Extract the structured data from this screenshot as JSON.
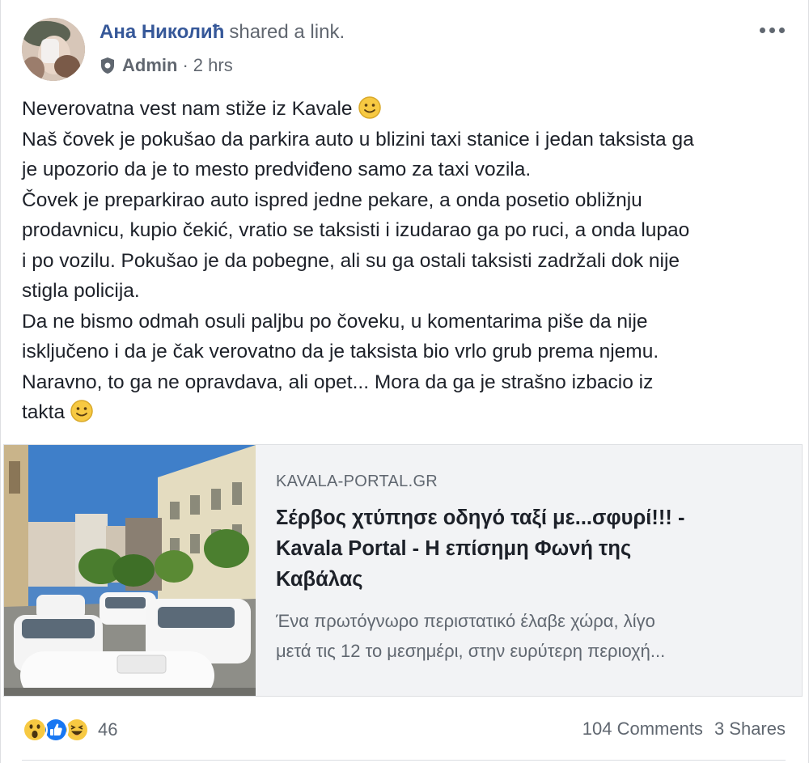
{
  "post": {
    "author_name": "Ана Николић",
    "action_text": "shared a link.",
    "role": "Admin",
    "time": "2 hrs",
    "more_icon": "more-options-icon",
    "paragraphs": [
      "Neverovatna vest nam stiže iz Kavale",
      "Naš čovek je pokušao da parkira auto u blizini taxi stanice i jedan taksista ga",
      "je upozorio da je to mesto predviđeno samo za taxi vozila.",
      "Čovek je preparkirao auto ispred jedne pekare, a onda posetio obližnju",
      "prodavnicu, kupio čekić, vratio se taksisti i izudarao ga po ruci, a onda lupao",
      "i po vozilu. Pokušao je da pobegne, ali su ga ostali taksisti zadržali dok nije",
      "stigla policija.",
      "Da ne bismo odmah osuli paljbu po čoveku, u komentarima piše da nije",
      "isključeno i da je čak verovatno da je taksista bio vrlo grub prema njemu.",
      "Naravno, to ga ne opravdava, ali opet... Mora da ga je strašno izbacio iz",
      "takta"
    ]
  },
  "link": {
    "domain": "KAVALA-PORTAL.GR",
    "title_lines": [
      "Σέρβος χτύπησε οδηγό ταξί με...σφυρί!!! -",
      "Kavala Portal - Η επίσημη Φωνή της",
      "Καβάλας"
    ],
    "desc_lines": [
      "Ένα πρωτόγνωρο περιστατικό έλαβε χώρα, λίγο",
      "μετά τις 12 το μεσημέρι, στην ευρύτερη περιοχή..."
    ]
  },
  "footer": {
    "reaction_icons": [
      "wow-reaction-icon",
      "like-reaction-icon",
      "haha-reaction-icon"
    ],
    "reaction_count": "46",
    "comments": "104 Comments",
    "shares": "3 Shares"
  },
  "colors": {
    "link_blue": "#365899",
    "meta_gray": "#616770",
    "like_blue": "#1877f2",
    "emoji_yellow": "#f7c942"
  }
}
